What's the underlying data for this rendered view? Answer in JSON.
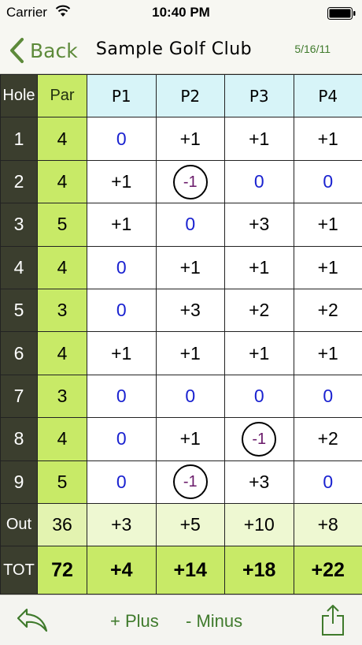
{
  "status": {
    "carrier": "Carrier",
    "time": "10:40 PM"
  },
  "nav": {
    "back_label": "Back",
    "title": "Sample Golf Club",
    "date": "5/16/11"
  },
  "headers": {
    "hole": "Hole",
    "par": "Par",
    "players": [
      "P1",
      "P2",
      "P3",
      "P4"
    ]
  },
  "holes": [
    {
      "hole": "1",
      "par": "4",
      "scores": [
        "0",
        "+1",
        "+1",
        "+1"
      ]
    },
    {
      "hole": "2",
      "par": "4",
      "scores": [
        "+1",
        "-1",
        "0",
        "0"
      ]
    },
    {
      "hole": "3",
      "par": "5",
      "scores": [
        "+1",
        "0",
        "+3",
        "+1"
      ]
    },
    {
      "hole": "4",
      "par": "4",
      "scores": [
        "0",
        "+1",
        "+1",
        "+1"
      ]
    },
    {
      "hole": "5",
      "par": "3",
      "scores": [
        "0",
        "+3",
        "+2",
        "+2"
      ]
    },
    {
      "hole": "6",
      "par": "4",
      "scores": [
        "+1",
        "+1",
        "+1",
        "+1"
      ]
    },
    {
      "hole": "7",
      "par": "3",
      "scores": [
        "0",
        "0",
        "0",
        "0"
      ]
    },
    {
      "hole": "8",
      "par": "4",
      "scores": [
        "0",
        "+1",
        "-1",
        "+2"
      ]
    },
    {
      "hole": "9",
      "par": "5",
      "scores": [
        "0",
        "-1",
        "+3",
        "0"
      ]
    }
  ],
  "out": {
    "label": "Out",
    "par": "36",
    "scores": [
      "+3",
      "+5",
      "+10",
      "+8"
    ]
  },
  "tot": {
    "label": "TOT",
    "par": "72",
    "scores": [
      "+4",
      "+14",
      "+18",
      "+22"
    ]
  },
  "toolbar": {
    "plus_label": "+ Plus",
    "minus_label": "- Minus"
  },
  "colors": {
    "accent": "#5d8a3a",
    "hole_bg": "#3b3e2e",
    "par_bg": "#c8ea67",
    "header_bg": "#d7f4f8",
    "zero": "#1a22d0",
    "under_par": "#6a1a6a"
  },
  "icons": {
    "back": "chevron-left-icon",
    "undo": "undo-arrow-icon",
    "share": "share-icon",
    "wifi": "wifi-icon",
    "battery": "battery-icon"
  }
}
